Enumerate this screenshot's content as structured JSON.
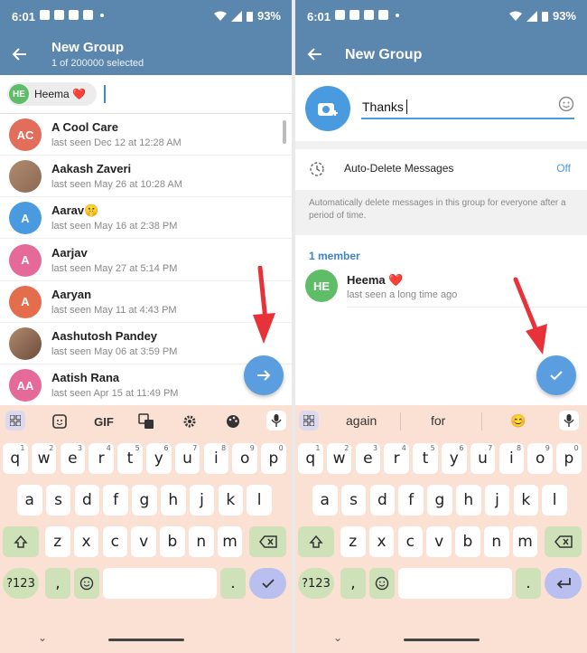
{
  "status": {
    "time": "6:01",
    "battery": "93%"
  },
  "left": {
    "title": "New Group",
    "subtitle": "1 of 200000 selected",
    "chip": {
      "initials": "HE",
      "name": "Heema ❤️"
    },
    "contacts": [
      {
        "initials": "AC",
        "name": "A Cool Care",
        "status": "last seen Dec 12 at 12:28 AM",
        "color": "#e26d5a"
      },
      {
        "initials": "",
        "name": "Aakash Zaveri",
        "status": "last seen May 26 at 10:28 AM",
        "color": "#8a6a54"
      },
      {
        "initials": "A",
        "name": "Aarav🤫",
        "status": "last seen May 16 at 2:38 PM",
        "color": "#4a9ae0"
      },
      {
        "initials": "A",
        "name": "Aarjav",
        "status": "last seen May 27 at 5:14 PM",
        "color": "#e56a9a"
      },
      {
        "initials": "A",
        "name": "Aaryan",
        "status": "last seen May 11 at 4:43 PM",
        "color": "#e46d4d"
      },
      {
        "initials": "",
        "name": "Aashutosh Pandey",
        "status": "last seen May 06 at 3:59 PM",
        "color": "#6b4c3c"
      },
      {
        "initials": "AA",
        "name": "Aatish Rana",
        "status": "last seen Apr 15 at 11:49 PM",
        "color": "#e56a9a"
      }
    ],
    "keyboard_tools": [
      "GIF"
    ]
  },
  "right": {
    "title": "New Group",
    "group_name": "Thanks",
    "auto_delete": {
      "label": "Auto-Delete Messages",
      "value": "Off"
    },
    "description": "Automatically delete messages in this group for everyone after a period of time.",
    "members_header": "1 member",
    "member": {
      "initials": "HE",
      "name": "Heema ❤️",
      "status": "last seen a long time ago"
    },
    "suggestions": [
      "again",
      "for",
      "😊"
    ]
  },
  "keyboard": {
    "row1": [
      "q",
      "w",
      "e",
      "r",
      "t",
      "y",
      "u",
      "i",
      "o",
      "p"
    ],
    "row1_hints": [
      "1",
      "2",
      "3",
      "4",
      "5",
      "6",
      "7",
      "8",
      "9",
      "0"
    ],
    "row2": [
      "a",
      "s",
      "d",
      "f",
      "g",
      "h",
      "j",
      "k",
      "l"
    ],
    "row3": [
      "z",
      "x",
      "c",
      "v",
      "b",
      "n",
      "m"
    ],
    "sym": "?123",
    "comma": ",",
    "period": "."
  },
  "colors": {
    "header": "#5b86ad",
    "accent": "#4a9ae0",
    "keyboard": "#fbe1d3",
    "annotation": "#e8323a"
  }
}
